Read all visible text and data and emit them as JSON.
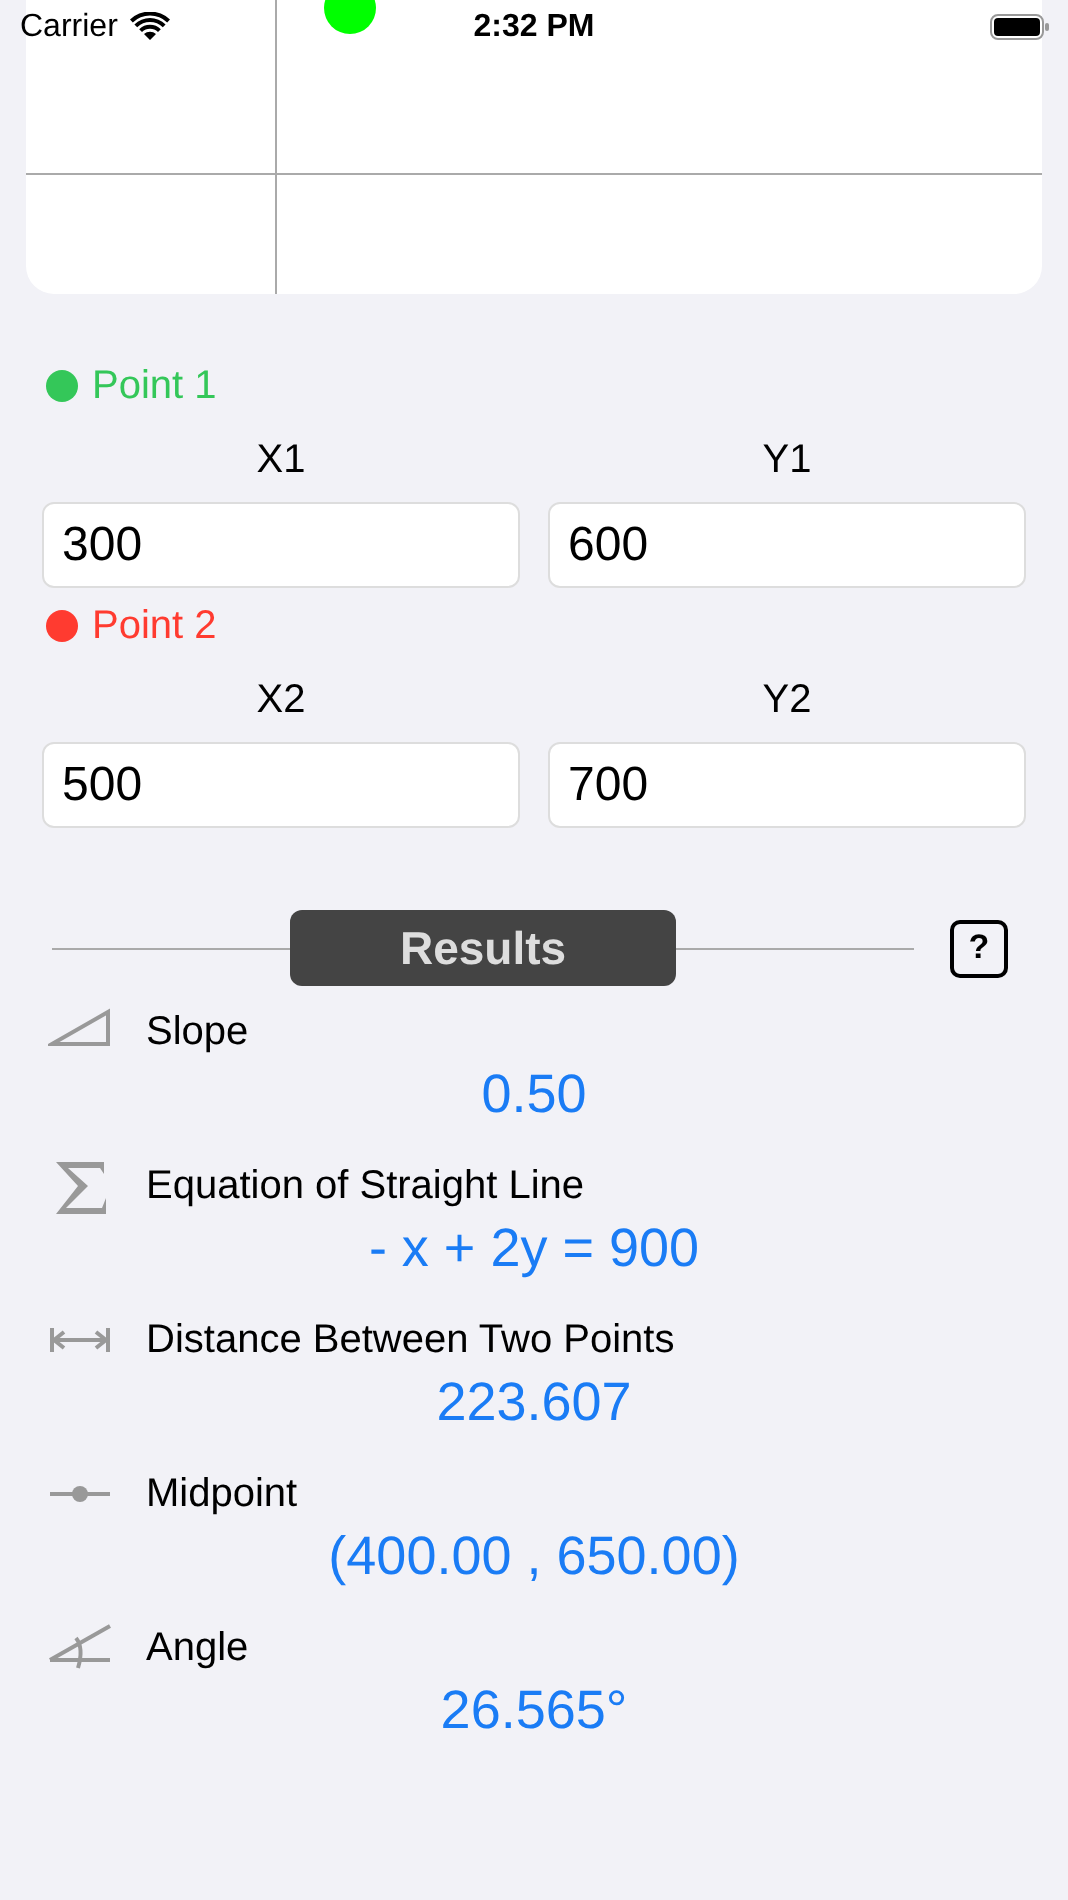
{
  "status_bar": {
    "carrier": "Carrier",
    "time": "2:32 PM"
  },
  "points": [
    {
      "label": "Point 1",
      "color": "#34c759",
      "fields": [
        {
          "label": "X1",
          "value": "300"
        },
        {
          "label": "Y1",
          "value": "600"
        }
      ]
    },
    {
      "label": "Point 2",
      "color": "#ff3b30",
      "fields": [
        {
          "label": "X2",
          "value": "500"
        },
        {
          "label": "Y2",
          "value": "700"
        }
      ]
    }
  ],
  "results_header": {
    "title": "Results",
    "help": "?"
  },
  "results": [
    {
      "kind": "slope",
      "title": "Slope",
      "result": "0.50"
    },
    {
      "kind": "equation",
      "title": "Equation of Straight Line",
      "result": "- x + 2y = 900"
    },
    {
      "kind": "distance",
      "title": "Distance Between Two Points",
      "result": "223.607"
    },
    {
      "kind": "midpoint",
      "title": "Midpoint",
      "result": "(400.00 , 650.00)"
    },
    {
      "kind": "angle",
      "title": "Angle",
      "result": "26.565°"
    }
  ]
}
